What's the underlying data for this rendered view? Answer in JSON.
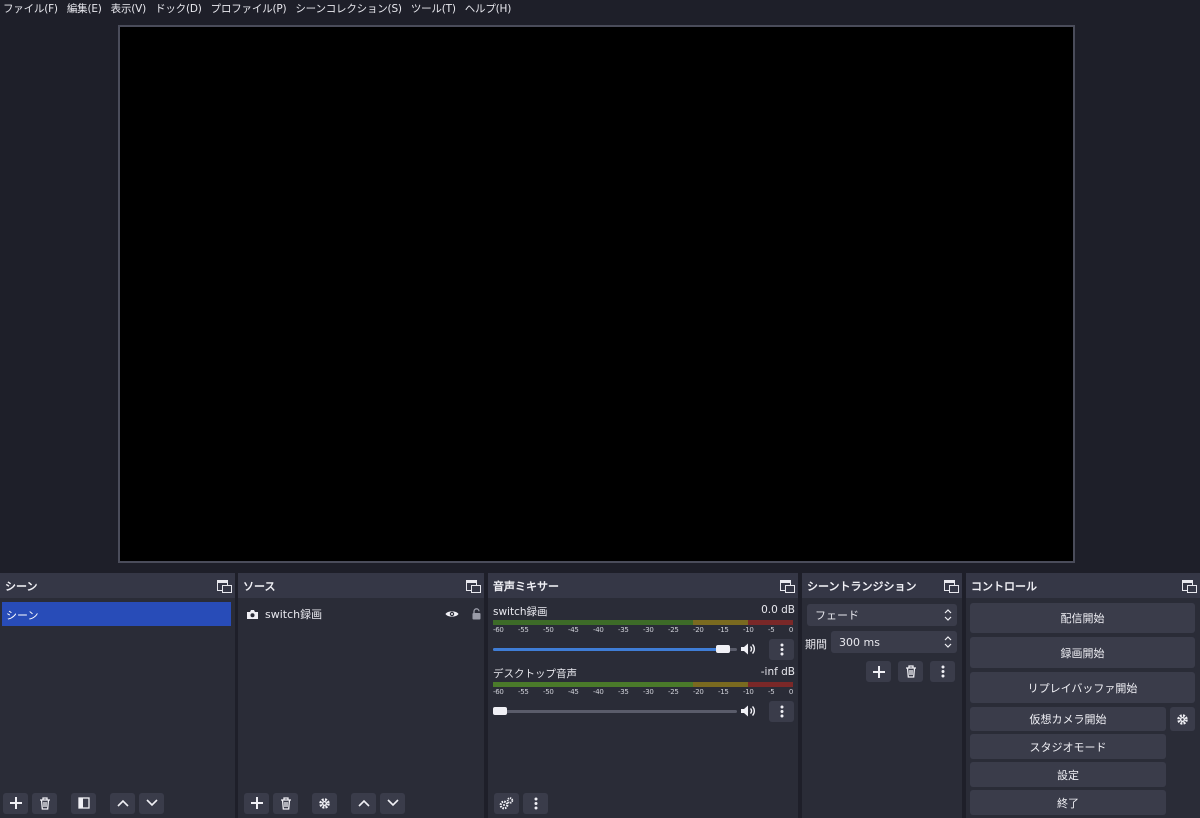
{
  "menu": [
    "ファイル(F)",
    "編集(E)",
    "表示(V)",
    "ドック(D)",
    "プロファイル(P)",
    "シーンコレクション(S)",
    "ツール(T)",
    "ヘルプ(H)"
  ],
  "docks": {
    "scenes": {
      "title": "シーン",
      "items": [
        "シーン"
      ]
    },
    "sources": {
      "title": "ソース",
      "items": [
        {
          "name": "switch録画",
          "icon": "camera-icon"
        }
      ]
    },
    "mixer": {
      "title": "音声ミキサー",
      "ticks": [
        "-60",
        "-55",
        "-50",
        "-45",
        "-40",
        "-35",
        "-30",
        "-25",
        "-20",
        "-15",
        "-10",
        "-5",
        "0"
      ],
      "channels": [
        {
          "name": "switch録画",
          "level": "0.0 dB",
          "fader": 0.97
        },
        {
          "name": "デスクトップ音声",
          "level": "-inf dB",
          "fader": 0.0
        }
      ]
    },
    "transition": {
      "title": "シーントランジション",
      "type": "フェード",
      "duration_label": "期間",
      "duration": "300 ms"
    },
    "controls": {
      "title": "コントロール",
      "buttons": [
        "配信開始",
        "録画開始",
        "リプレイバッファ開始",
        "仮想カメラ開始",
        "スタジオモード",
        "設定",
        "終了"
      ]
    }
  },
  "colors": {
    "accent": "#284cb8",
    "fader_fill": "#3f7dd6",
    "background": "#1e1f29",
    "panel": "#2a2c37"
  }
}
